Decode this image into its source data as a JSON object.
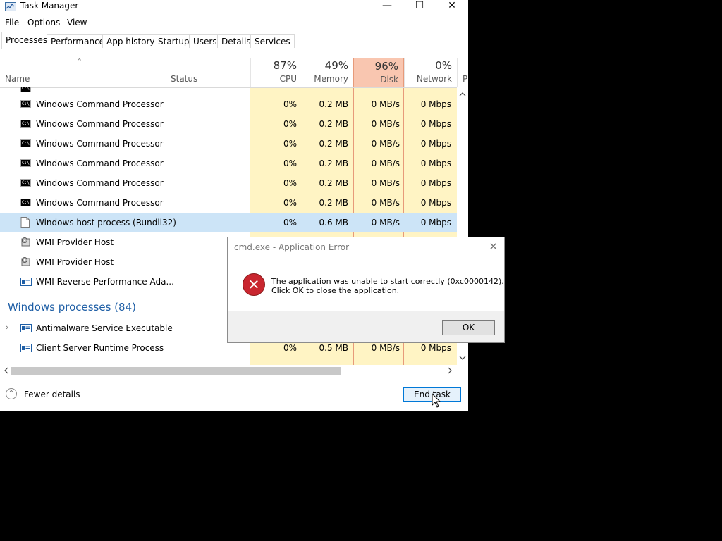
{
  "window": {
    "title": "Task Manager",
    "minimize": "—",
    "maximize": "☐",
    "close": "✕"
  },
  "menu": [
    "File",
    "Options",
    "View"
  ],
  "tabs": [
    "Processes",
    "Performance",
    "App history",
    "Startup",
    "Users",
    "Details",
    "Services"
  ],
  "columns": {
    "name": "Name",
    "status": "Status",
    "cpu": {
      "pct": "87%",
      "label": "CPU"
    },
    "memory": {
      "pct": "49%",
      "label": "Memory"
    },
    "disk": {
      "pct": "96%",
      "label": "Disk"
    },
    "network": {
      "pct": "0%",
      "label": "Network"
    },
    "power": "P"
  },
  "rows": [
    {
      "name": "Windows Command Processor",
      "icon": "cmd-icon",
      "cpu": "0%",
      "memory": "0.2 MB",
      "disk": "0 MB/s",
      "network": "0 Mbps"
    },
    {
      "name": "Windows Command Processor",
      "icon": "cmd-icon",
      "cpu": "0%",
      "memory": "0.2 MB",
      "disk": "0 MB/s",
      "network": "0 Mbps"
    },
    {
      "name": "Windows Command Processor",
      "icon": "cmd-icon",
      "cpu": "0%",
      "memory": "0.2 MB",
      "disk": "0 MB/s",
      "network": "0 Mbps"
    },
    {
      "name": "Windows Command Processor",
      "icon": "cmd-icon",
      "cpu": "0%",
      "memory": "0.2 MB",
      "disk": "0 MB/s",
      "network": "0 Mbps"
    },
    {
      "name": "Windows Command Processor",
      "icon": "cmd-icon",
      "cpu": "0%",
      "memory": "0.2 MB",
      "disk": "0 MB/s",
      "network": "0 Mbps"
    },
    {
      "name": "Windows Command Processor",
      "icon": "cmd-icon",
      "cpu": "0%",
      "memory": "0.2 MB",
      "disk": "0 MB/s",
      "network": "0 Mbps"
    },
    {
      "name": "Windows host process (Rundll32)",
      "icon": "document-icon",
      "cpu": "0%",
      "memory": "0.6 MB",
      "disk": "0 MB/s",
      "network": "0 Mbps",
      "selected": true
    },
    {
      "name": "WMI Provider Host",
      "icon": "wmi-icon"
    },
    {
      "name": "WMI Provider Host",
      "icon": "wmi-icon"
    },
    {
      "name": "WMI Reverse Performance Ada...",
      "icon": "service-icon"
    }
  ],
  "group": {
    "label": "Windows processes (84)"
  },
  "group_rows": [
    {
      "name": "Antimalware Service Executable",
      "icon": "service-icon",
      "expandable": true
    },
    {
      "name": "Client Server Runtime Process",
      "icon": "service-icon",
      "cpu": "0%",
      "memory": "0.5 MB",
      "disk": "0 MB/s",
      "network": "0 Mbps"
    }
  ],
  "footer": {
    "fewer_details": "Fewer details",
    "end_task": "End task"
  },
  "dialog": {
    "title": "cmd.exe - Application Error",
    "message_line1": "The application was unable to start correctly (0xc0000142).",
    "message_line2": "Click OK to close the application.",
    "ok": "OK",
    "close": "✕"
  },
  "colors": {
    "heat_light": "#fff4c4",
    "heat_disk_header": "#f9c6b0",
    "heat_disk_border": "#e79a7a",
    "selected_row": "#cce4f7",
    "group_text": "#1f5fa6"
  }
}
